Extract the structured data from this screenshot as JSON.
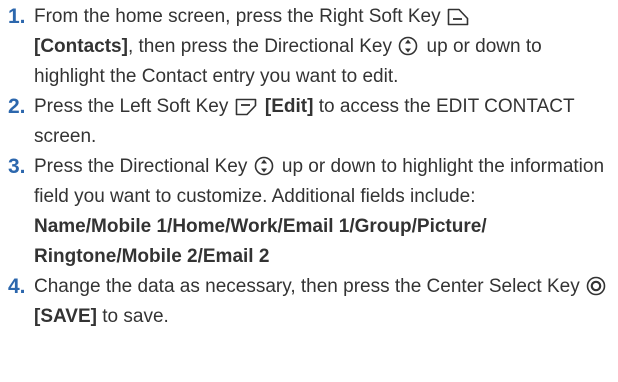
{
  "steps": [
    {
      "number": "1.",
      "parts": [
        "From the home screen, press the Right Soft Key",
        "[Contacts]",
        ", then press the Directional Key",
        "up or down to highlight the Contact entry you want to edit."
      ],
      "icons": [
        "right-soft-key-icon",
        "directional-key-icon"
      ]
    },
    {
      "number": "2.",
      "parts": [
        "Press the Left Soft Key",
        "[Edit]",
        "to access the EDIT CONTACT screen."
      ],
      "icons": [
        "left-soft-key-icon"
      ]
    },
    {
      "number": "3.",
      "parts": [
        "Press the Directional Key",
        "up or down to highlight the information field you want to customize. Additional fields include:",
        "Name/Mobile 1/Home/Work/Email 1/Group/Picture/ Ringtone/Mobile 2/Email 2"
      ],
      "icons": [
        "directional-key-icon"
      ]
    },
    {
      "number": "4.",
      "parts": [
        "Change the data as necessary, then press the Center Select Key",
        "[SAVE]",
        "to save."
      ],
      "icons": [
        "center-select-key-icon"
      ]
    }
  ],
  "colors": {
    "step_number": "#2c67ad",
    "body_text": "#333333",
    "background": "#ffffff"
  }
}
